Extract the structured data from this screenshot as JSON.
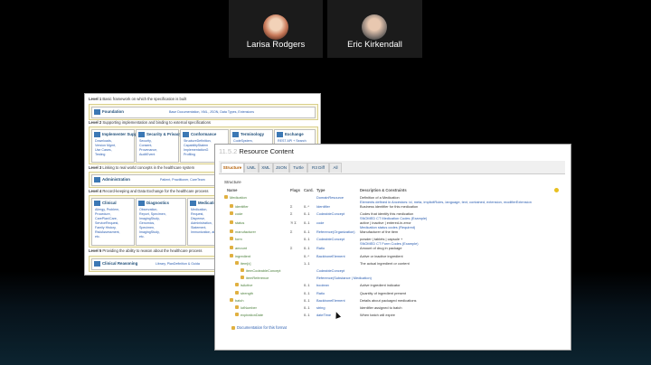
{
  "participants": [
    {
      "name": "Larisa Rodgers"
    },
    {
      "name": "Eric Kirkendall"
    }
  ],
  "overview": {
    "levels": [
      {
        "num": "Level 1",
        "text": "Basic framework on which the specification is built"
      },
      {
        "num": "Level 2",
        "text": "Supporting implementation and binding to external specifications"
      },
      {
        "num": "Level 3",
        "text": "Linking to real world concepts in the healthcare system"
      },
      {
        "num": "Level 4",
        "text": "Record-keeping and Data Exchange for the healthcare process"
      },
      {
        "num": "Level 5",
        "text": "Providing the ability to reason about the healthcare process"
      }
    ],
    "foundation": {
      "label": "Foundation",
      "items": "Base Documentation, XML, JSON, Data Types, Extensions"
    },
    "l2boxes": [
      {
        "label": "Implementer Support",
        "items": [
          "Downloads,",
          "Version Mgmt,",
          "Use Cases,",
          "Testing"
        ]
      },
      {
        "label": "Security & Privacy",
        "items": [
          "Security,",
          "Consent,",
          "Provenance,",
          "AuditEvent"
        ]
      },
      {
        "label": "Conformance",
        "items": [
          "StructureDefinition,",
          "CapabilityStatem",
          "ImplementationG",
          "Profiling"
        ]
      },
      {
        "label": "Terminology",
        "items": [
          "CodeSystem,",
          "ValueSet,"
        ]
      },
      {
        "label": "Exchange",
        "items": [
          "REST API + Search"
        ]
      }
    ],
    "administration": {
      "label": "Administration",
      "items": "Patient, Practitioner, CareTeam"
    },
    "l4boxes": [
      {
        "label": "Clinical",
        "items": [
          "Allergy, Problem,",
          "Procedure,",
          "CarePlan/Care,",
          "ServiceRequest,",
          "Family History,",
          "RiskAssessment,",
          "etc."
        ]
      },
      {
        "label": "Diagnostics",
        "items": [
          "Observation,",
          "Report, Specimen,",
          "ImagingStudy,",
          "Genomics,",
          "Specimen,",
          "ImagingStudy,",
          "etc."
        ]
      },
      {
        "label": "Medications",
        "items": [
          "Medication,",
          "Request,",
          "Dispense,",
          "Administration,",
          "Statement,",
          "Immunization, all"
        ]
      }
    ],
    "reasoning": {
      "label": "Clinical Reasoning",
      "items": "Library, PlanDefinition & Guida"
    }
  },
  "resource": {
    "title_num": "11.5.2",
    "title": "Resource Content",
    "tabs": [
      "Structure",
      "UML",
      "XML",
      "JSON",
      "Turtle",
      "R3 Diff",
      "All"
    ],
    "section": "Structure",
    "headers": {
      "name": "Name",
      "flags": "Flags",
      "card": "Card.",
      "type": "Type",
      "desc": "Description & Constraints"
    },
    "rows": [
      {
        "name": "Medication",
        "flags": "",
        "card": "",
        "type": "DomainResource",
        "desc": "Definition of a Medication",
        "desc2": "Elements defined in Ancestors: id, meta, implicitRules, language, text, contained, extension, modifierExtension"
      },
      {
        "name": "identifier",
        "flags": "Σ",
        "card": "0..*",
        "type": "Identifier",
        "desc": "Business identifier for this medication"
      },
      {
        "name": "code",
        "flags": "Σ",
        "card": "0..1",
        "type": "CodeableConcept",
        "desc": "Codes that identify this medication",
        "desc2": "SNOMED CT Medication Codes (Example)"
      },
      {
        "name": "status",
        "flags": "?! Σ",
        "card": "0..1",
        "type": "code",
        "desc": "active | inactive | entered-in-error",
        "desc2": "Medication status codes (Required)"
      },
      {
        "name": "manufacturer",
        "flags": "Σ",
        "card": "0..1",
        "type": "Reference(Organization)",
        "desc": "Manufacturer of the item"
      },
      {
        "name": "form",
        "flags": "",
        "card": "0..1",
        "type": "CodeableConcept",
        "desc": "powder | tablets | capsule +",
        "desc2": "SNOMED CT Form Codes (Example)"
      },
      {
        "name": "amount",
        "flags": "Σ",
        "card": "0..1",
        "type": "Ratio",
        "desc": "Amount of drug in package"
      },
      {
        "name": "ingredient",
        "flags": "",
        "card": "0..*",
        "type": "BackboneElement",
        "desc": "Active or inactive ingredient"
      },
      {
        "name": "item[x]",
        "flags": "",
        "card": "1..1",
        "type": "",
        "desc": "The actual ingredient or content"
      },
      {
        "name": "itemCodeableConcept",
        "flags": "",
        "card": "",
        "type": "CodeableConcept",
        "desc": ""
      },
      {
        "name": "itemReference",
        "flags": "",
        "card": "",
        "type": "Reference(Substance | Medication)",
        "desc": ""
      },
      {
        "name": "isActive",
        "flags": "",
        "card": "0..1",
        "type": "boolean",
        "desc": "Active ingredient indicator"
      },
      {
        "name": "strength",
        "flags": "",
        "card": "0..1",
        "type": "Ratio",
        "desc": "Quantity of ingredient present"
      },
      {
        "name": "batch",
        "flags": "",
        "card": "0..1",
        "type": "BackboneElement",
        "desc": "Details about packaged medications"
      },
      {
        "name": "lotNumber",
        "flags": "",
        "card": "0..1",
        "type": "string",
        "desc": "Identifier assigned to batch"
      },
      {
        "name": "expirationDate",
        "flags": "",
        "card": "0..1",
        "type": "dateTime",
        "desc": "When batch will expire"
      }
    ],
    "doc_link": "Documentation for this format"
  }
}
